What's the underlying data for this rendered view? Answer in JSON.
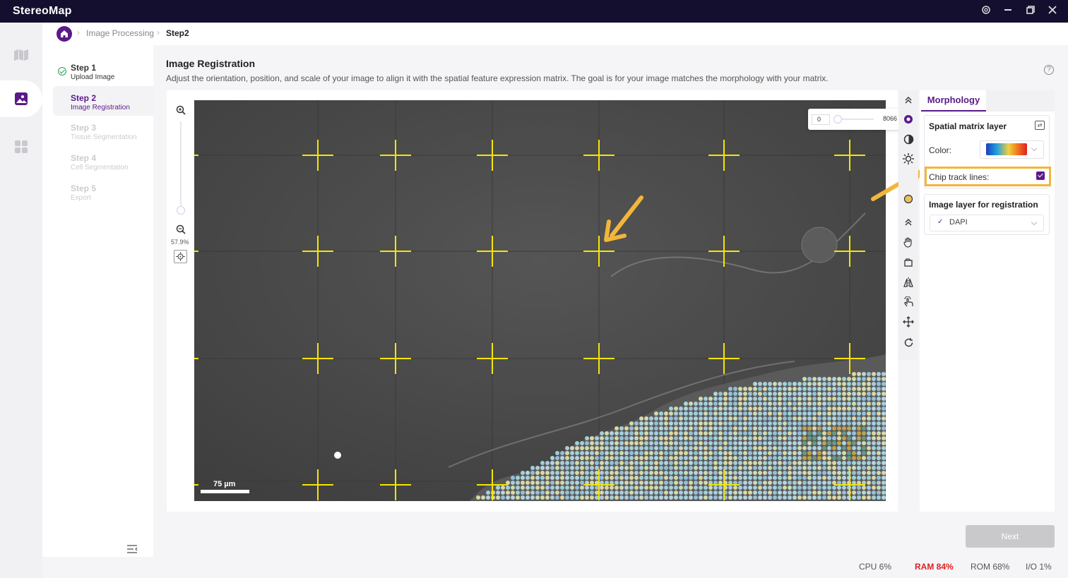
{
  "app": {
    "title": "StereoMap"
  },
  "breadcrumb": {
    "items": [
      "Image Processing",
      "Step2"
    ]
  },
  "steps": [
    {
      "title": "Step 1",
      "subtitle": "Upload Image",
      "state": "done"
    },
    {
      "title": "Step 2",
      "subtitle": "Image Registration",
      "state": "active"
    },
    {
      "title": "Step 3",
      "subtitle": "Tissue Segmentation",
      "state": "disabled"
    },
    {
      "title": "Step 4",
      "subtitle": "Cell Segmentation",
      "state": "disabled"
    },
    {
      "title": "Step 5",
      "subtitle": "Export",
      "state": "disabled"
    }
  ],
  "main": {
    "title": "Image Registration",
    "description": "Adjust the orientation, position, and scale of your image to align it with the spatial feature expression matrix. The goal is for your image matches the morphology with your matrix.",
    "zoom_percent": "57.9%",
    "scale_bar": "75 µm",
    "intensity_range": {
      "min": "0",
      "max": "8066"
    }
  },
  "panel": {
    "tab": "Morphology",
    "spatial_layer_heading": "Spatial matrix layer",
    "color_label": "Color:",
    "chip_track_label": "Chip track lines:",
    "chip_track_checked": true,
    "image_layer_heading": "Image layer for registration",
    "image_layer_value": "DAPI"
  },
  "buttons": {
    "next": "Next"
  },
  "status": {
    "cpu": "CPU  6%",
    "ram": "RAM  84%",
    "rom": "ROM  68%",
    "io": "I/O  1%"
  },
  "colors": {
    "accent": "#5a1a8a",
    "highlight": "#f2b63a",
    "titlebar": "#140f2e"
  }
}
